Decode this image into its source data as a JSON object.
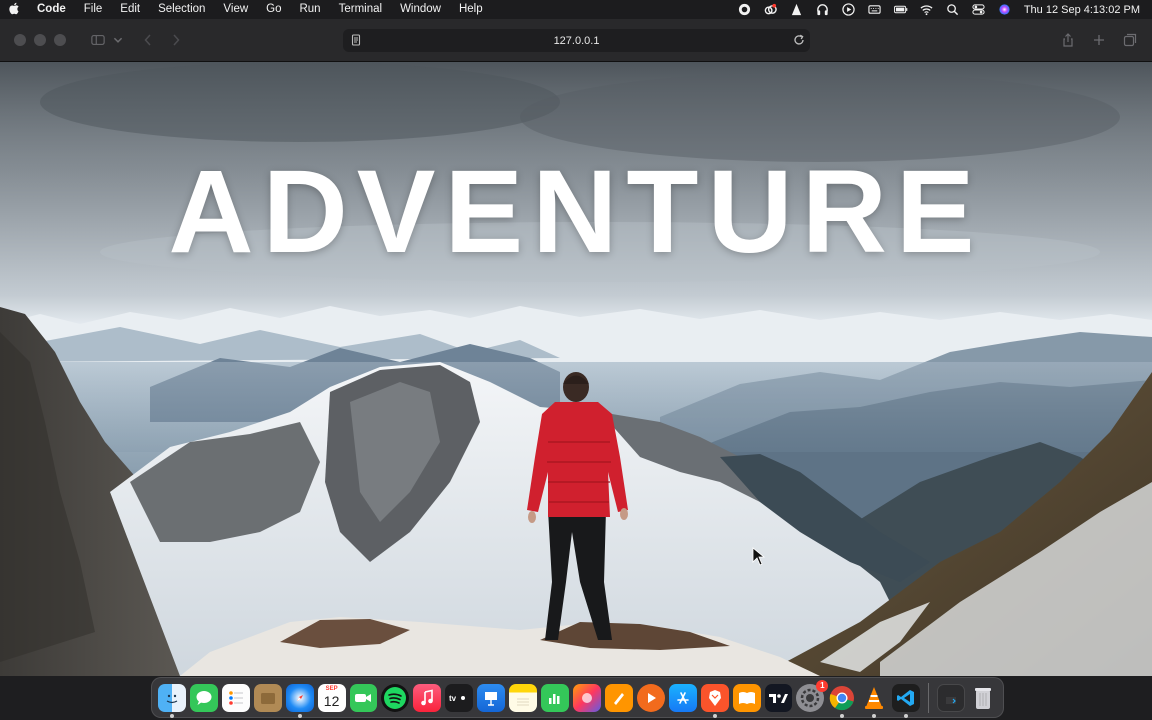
{
  "menubar": {
    "app_name": "Code",
    "items": [
      "File",
      "Edit",
      "Selection",
      "View",
      "Go",
      "Run",
      "Terminal",
      "Window",
      "Help"
    ],
    "clock": "Thu 12 Sep  4:13:02 PM",
    "status_icons": [
      "record-icon",
      "creative-cloud-icon",
      "vlc-icon",
      "headphones-icon",
      "play-circle-icon",
      "keyboard-icon",
      "battery-icon",
      "wifi-icon",
      "search-icon",
      "control-center-icon",
      "siri-icon"
    ]
  },
  "browser": {
    "url": "127.0.0.1"
  },
  "hero": {
    "title": "ADVENTURE"
  },
  "dock": {
    "calendar_month": "SEP",
    "calendar_day": "12",
    "settings_badge": "1",
    "apps": [
      "finder",
      "messages",
      "reminders",
      "notes-folder",
      "safari",
      "calendar",
      "facetime",
      "spotify",
      "music",
      "apple-tv",
      "keynote",
      "notes",
      "numbers",
      "pixelmator",
      "pages",
      "infuse",
      "app-store",
      "brave",
      "books",
      "tradingview",
      "system-settings",
      "chrome",
      "vlc",
      "vscode",
      "downloads",
      "trash"
    ]
  },
  "colors": {
    "menubar_bg": "#1c1c1e",
    "toolbar_bg": "#29292b",
    "jacket_red": "#d0202e"
  }
}
